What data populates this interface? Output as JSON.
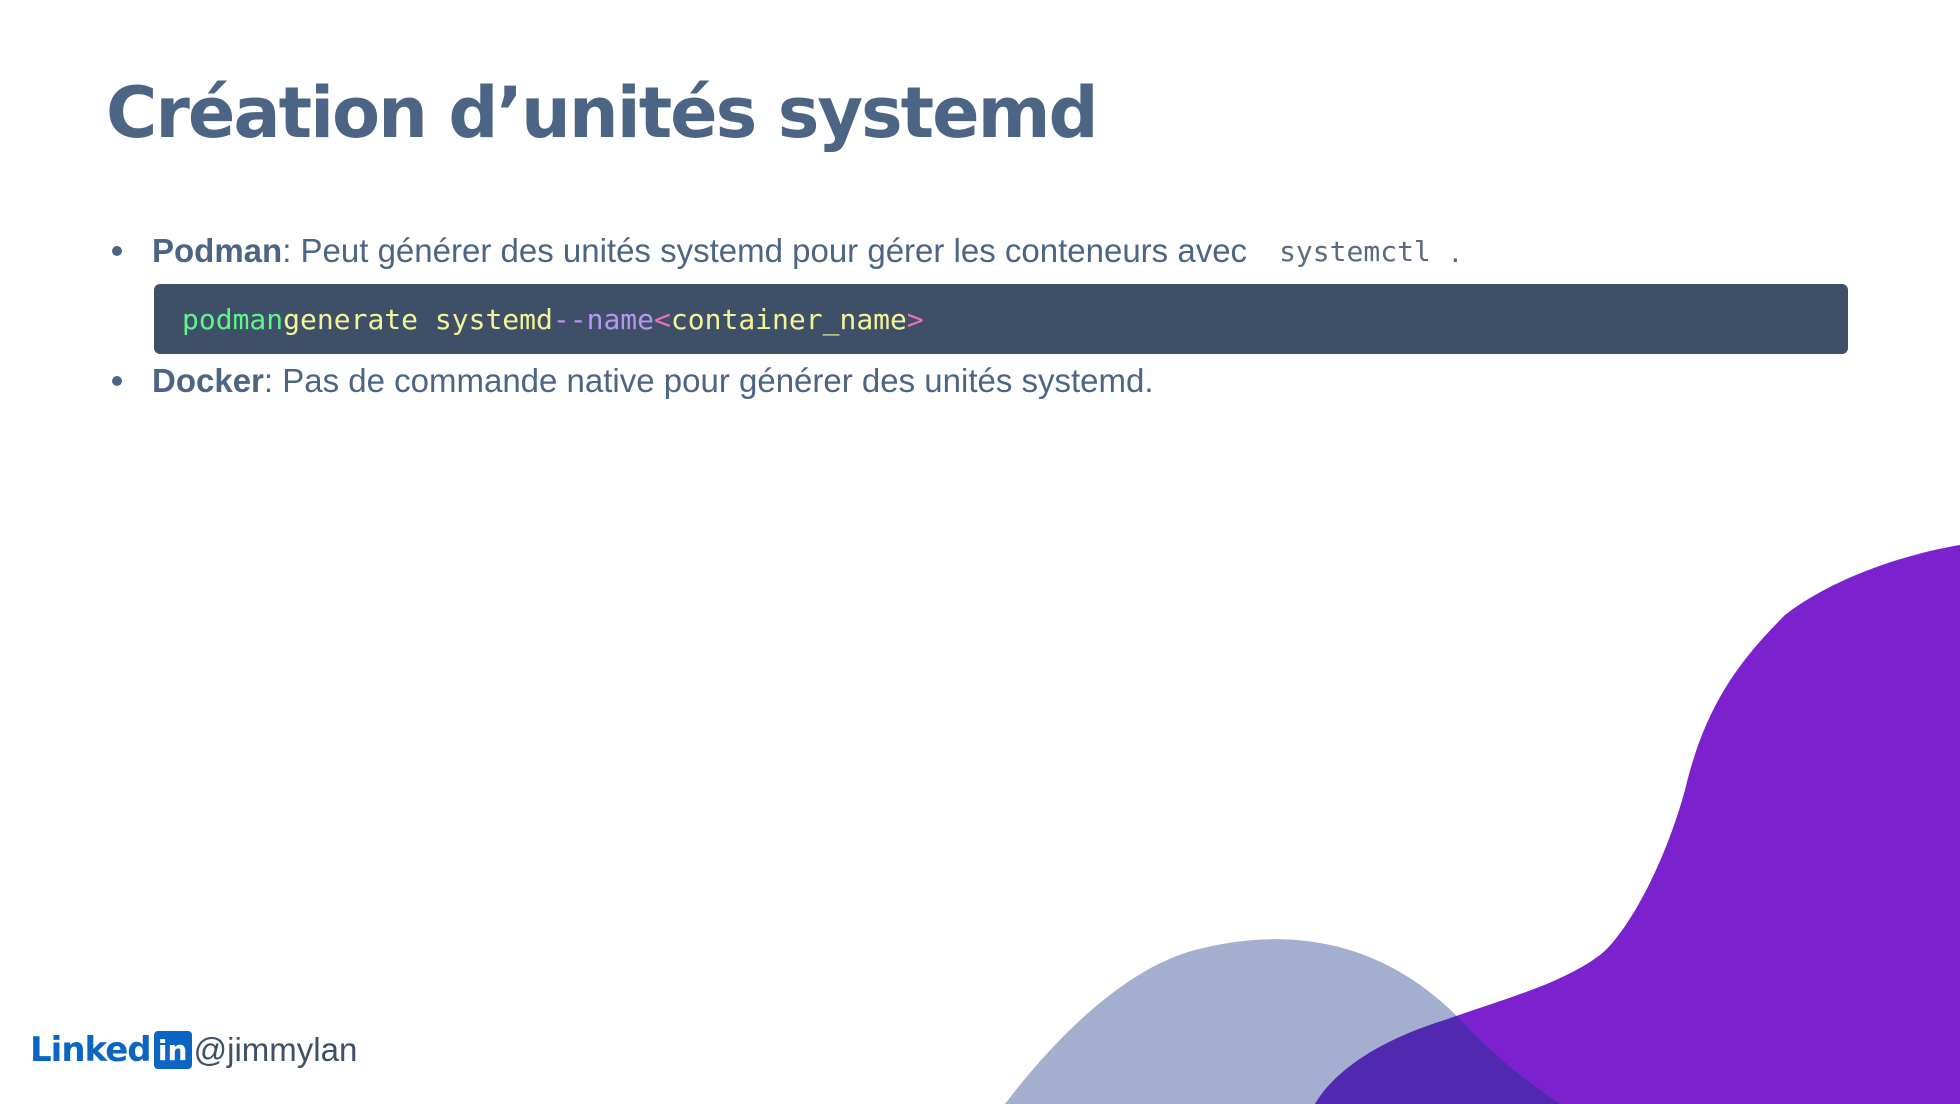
{
  "slide": {
    "title": "Création d’unités systemd"
  },
  "bullets": [
    {
      "label": "Podman",
      "text": " : Peut générer des unités systemd pour gérer les conteneurs avec",
      "inline_code": "systemctl",
      "suffix": "."
    },
    {
      "label": "Docker",
      "text": " : Pas de commande native pour générer des unités systemd."
    }
  ],
  "code": {
    "cmd": "podman",
    "args": "generate systemd",
    "flag": "--name",
    "open": "<",
    "placeholder": "container_name",
    "close": ">"
  },
  "footer": {
    "brand_text": "Linked",
    "brand_box": "in",
    "handle": "@jimmylan"
  },
  "colors": {
    "title": "#4d6584",
    "code_bg": "#3e5068",
    "purple_blob": "#7b22ce",
    "slate_blob": "#a4afcf",
    "overlap": "#5129b0",
    "linkedin": "#0a66c2"
  }
}
